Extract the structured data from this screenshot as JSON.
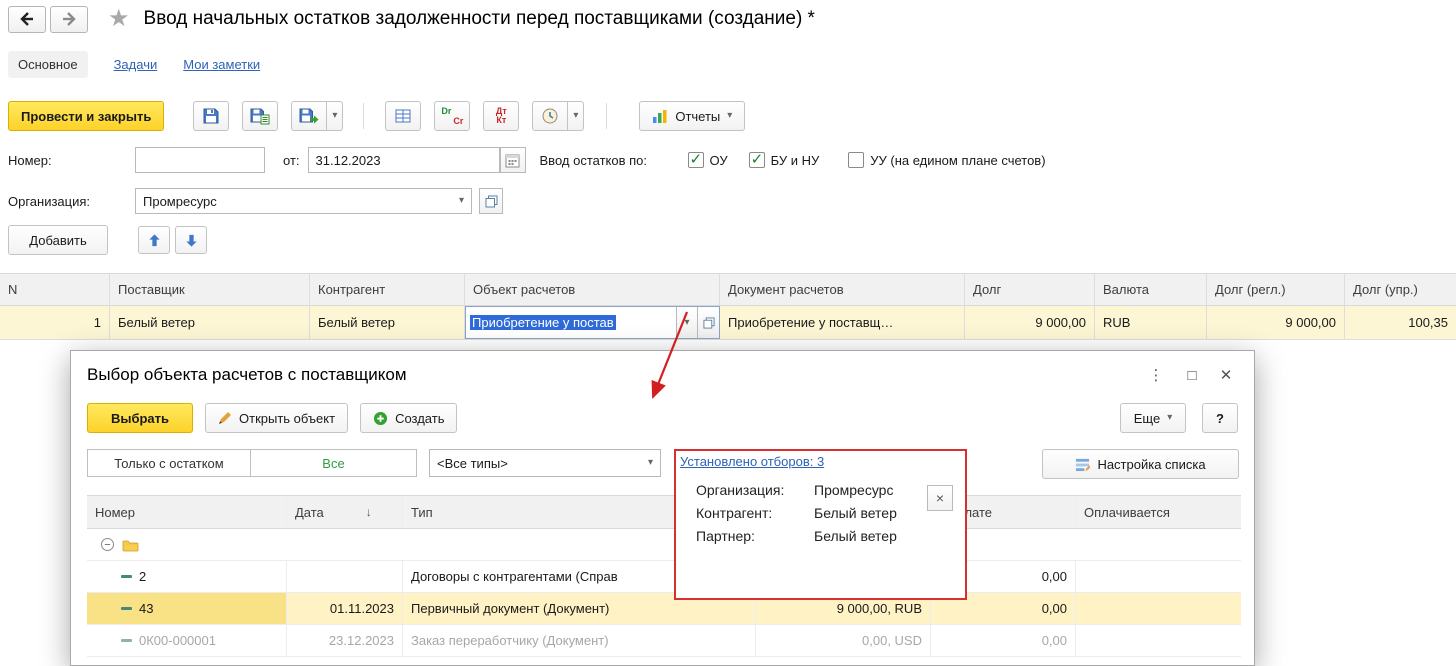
{
  "icons": {
    "star": "★",
    "caret_down": "▾",
    "sort_desc": "↓",
    "dialog_more_dots": "⋮",
    "dialog_maximize": "□",
    "dialog_close": "✕",
    "popup_close": "×",
    "collapse_minus": "−"
  },
  "header": {
    "title": "Ввод начальных остатков задолженности перед поставщиками (создание) *"
  },
  "nav": {
    "tabs": [
      {
        "label": "Основное",
        "active": true
      },
      {
        "label": "Задачи",
        "active": false
      },
      {
        "label": "Мои заметки",
        "active": false
      }
    ]
  },
  "toolbar": {
    "post_and_close": "Провести и закрыть",
    "reports": "Отчеты"
  },
  "form": {
    "number_label": "Номер:",
    "number_value": "",
    "date_label": "от:",
    "date_value": "31.12.2023",
    "balances_label": "Ввод остатков по:",
    "checkbox_ou": "ОУ",
    "checkbox_ou_checked": true,
    "checkbox_bu": "БУ и НУ",
    "checkbox_bu_checked": true,
    "checkbox_uu": "УУ (на едином плане счетов)",
    "checkbox_uu_checked": false,
    "org_label": "Организация:",
    "org_value": "Промресурс",
    "add_button": "Добавить"
  },
  "main_table": {
    "headers": [
      "N",
      "Поставщик",
      "Контрагент",
      "Объект расчетов",
      "Документ расчетов",
      "Долг",
      "Валюта",
      "Долг (регл.)",
      "Долг (упр.)"
    ],
    "row": {
      "n": "1",
      "supplier": "Белый ветер",
      "contragent": "Белый ветер",
      "settlement_object_edit": "Приобретение у постав",
      "settlement_document": "Приобретение у поставщ…",
      "debt": "9 000,00",
      "currency": "RUB",
      "debt_reg": "9 000,00",
      "debt_mgmt": "100,35"
    }
  },
  "dialog": {
    "title": "Выбор объекта расчетов с поставщиком",
    "select_button": "Выбрать",
    "open_button": "Открыть объект",
    "create_button": "Создать",
    "more_button": "Еще",
    "help_button": "?",
    "filter_only_balance": "Только с остатком",
    "filter_all": "Все",
    "filter_types": "<Все типы>",
    "filters_applied_link": "Установлено отборов: 3",
    "list_settings_button": "Настройка списка",
    "filter_popup": {
      "org_label": "Организация:",
      "org_value": "Промресурс",
      "contragent_label": "Контрагент:",
      "contragent_value": "Белый ветер",
      "partner_label": "Партнер:",
      "partner_value": "Белый ветер"
    },
    "table": {
      "headers": {
        "number": "Номер",
        "date": "Дата",
        "type": "Тип",
        "sum": "",
        "to_pay": "К оплате",
        "paid": "Оплачивается"
      },
      "rows": [
        {
          "number": "2",
          "date": "",
          "type": "Договоры с контрагентами (Справ",
          "sum": "",
          "to_pay": "0,00"
        },
        {
          "number": "43",
          "date": "01.11.2023",
          "type": "Первичный документ (Документ)",
          "sum": "9 000,00, RUB",
          "to_pay": "0,00"
        },
        {
          "number": "0К00-000001",
          "date": "23.12.2023",
          "type": "Заказ переработчику (Документ)",
          "sum": "0,00, USD",
          "to_pay": "0,00"
        }
      ]
    }
  }
}
